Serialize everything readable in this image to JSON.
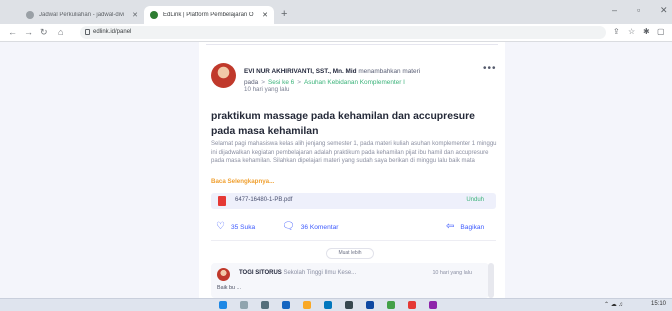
{
  "browser": {
    "tabs": [
      {
        "title": "Jadwal Perkuliahan - jadwal-divi",
        "icon": "globe-icon",
        "icon_color": "#5f6368"
      },
      {
        "title": "EdLink | Platform Pembelajaran O",
        "icon": "edlink-icon",
        "icon_color": "#2e7d32"
      }
    ],
    "new_tab": "+",
    "url": "edlink.id/panel",
    "window_controls": [
      "–",
      "▫",
      "✕"
    ]
  },
  "post": {
    "author": "EVI NUR AKHIRIVANTI, SST., Mn. Mid",
    "action_text": "menambahkan materi",
    "breadcrumb": [
      "pada",
      "Sesi ke 6",
      "Asuhan Kebidanan Komplementer I"
    ],
    "time_ago": "10 hari yang lalu",
    "menu": "•••",
    "title": "praktikum massage pada kehamilan dan accupresure pada masa kehamilan",
    "body": "Selamat pagi mahasiswa kelas alih jenjang semester 1, pada materi kuliah asuhan komplementer 1 minggu ini dijadwalkan kegiatan pembelajaran adalah praktikum pada kehamilan pijat ibu hamil dan accupresure pada masa kehamilan. Silahkan dipelajari materi yang sudah saya berikan di minggu lalu baik mata",
    "read_more": "Baca Selengkapnya...",
    "attachment": {
      "name": "6477-16480-1-PB.pdf",
      "action": "Unduh"
    },
    "likes": "35 Suka",
    "comments": "36 Komentar",
    "share": "Bagikan",
    "load_more": "Muat lebih"
  },
  "comment": {
    "author": "TOGI SITORUS",
    "affiliation": "Sekolah Tinggi Ilmu Kese...",
    "time_ago": "10 hari yang lalu",
    "text": "Baik bu ..."
  },
  "taskbar": {
    "time": "15:10"
  },
  "colors": {
    "accent": "#3d5afe",
    "link_green": "#3bb37a",
    "read_more": "#f0a030"
  }
}
